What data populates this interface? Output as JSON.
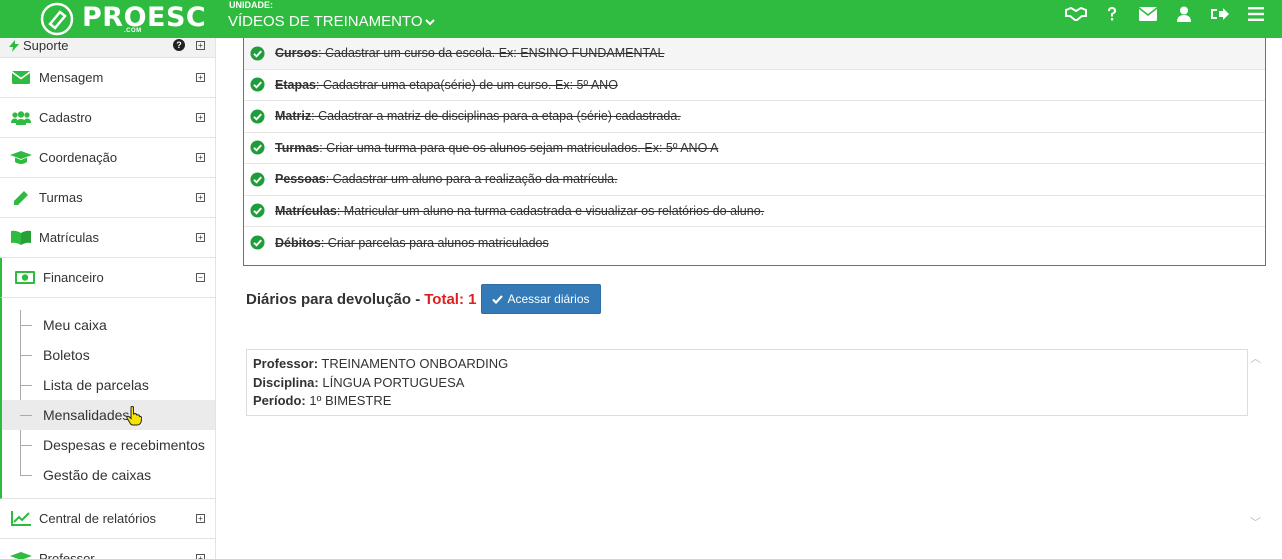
{
  "header": {
    "logo_text": "PROESC",
    "logo_sub": ".COM",
    "unit_label": "UNIDADE:",
    "unit_value": "VÍDEOS DE TREINAMENTO",
    "brand_color": "#2fbb3f",
    "icons": [
      "handshake-icon",
      "question-icon",
      "envelope-icon",
      "user-icon",
      "sign-out-icon",
      "hamburger-menu-icon"
    ]
  },
  "sidebar": {
    "top_item": "Suporte",
    "items": [
      {
        "label": "Mensagem",
        "icon": "envelope-icon"
      },
      {
        "label": "Cadastro",
        "icon": "users-icon"
      },
      {
        "label": "Coordenação",
        "icon": "graduation-cap-icon"
      },
      {
        "label": "Turmas",
        "icon": "pencil-icon"
      },
      {
        "label": "Matrículas",
        "icon": "book-icon"
      },
      {
        "label": "Financeiro",
        "icon": "money-icon"
      }
    ],
    "financeiro_sub": [
      "Meu caixa",
      "Boletos",
      "Lista de parcelas",
      "Mensalidades",
      "Despesas e recebimentos",
      "Gestão de caixas"
    ],
    "after": [
      {
        "label": "Central de relatórios",
        "icon": "line-chart-icon"
      },
      {
        "label": "Professor",
        "icon": "graduation-cap-icon"
      }
    ],
    "expand_symbol": "⊞",
    "help_symbol": "?"
  },
  "checklist": [
    {
      "title": "Cursos",
      "text": ": Cadastrar um curso da escola. Ex: ENSINO FUNDAMENTAL"
    },
    {
      "title": "Etapas",
      "text": ": Cadastrar uma etapa(série) de um curso. Ex: 5º ANO"
    },
    {
      "title": "Matriz",
      "text": ": Cadastrar a matriz de disciplinas para a etapa (série) cadastrada."
    },
    {
      "title": "Turmas",
      "text": ": Criar uma turma para que os alunos sejam matriculados. Ex: 5º ANO A"
    },
    {
      "title": "Pessoas",
      "text": ": Cadastrar um aluno para a realização da matrícula."
    },
    {
      "title": "Matrículas",
      "text": ": Matricular um aluno na turma cadastrada e visualizar os relatórios do aluno."
    },
    {
      "title": "Débitos",
      "text": ": Criar parcelas para alunos matriculados"
    }
  ],
  "diarios": {
    "title": "Diários para devolução -",
    "total_label": "Total: 1",
    "button_label": "Acessar diários"
  },
  "teacher": {
    "professor_label": "Professor:",
    "professor_value": "TREINAMENTO ONBOARDING",
    "disciplina_label": "Disciplina:",
    "disciplina_value": "LÍNGUA PORTUGUESA",
    "periodo_label": "Período:",
    "periodo_value": "1º BIMESTRE"
  }
}
